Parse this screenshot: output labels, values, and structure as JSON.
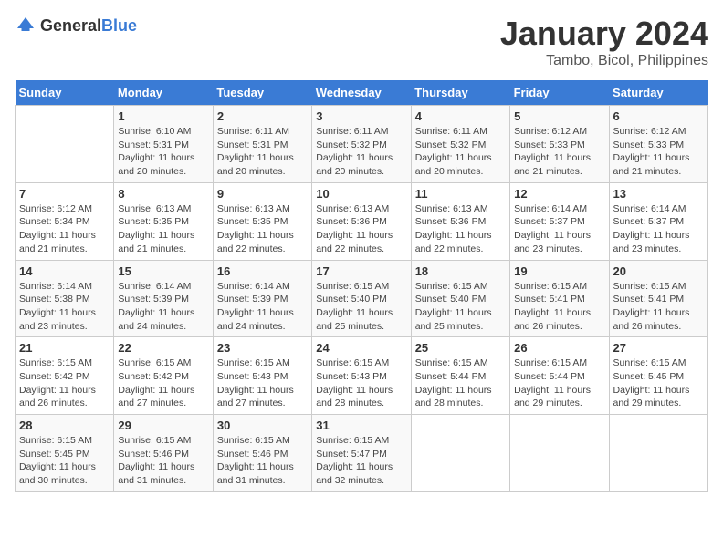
{
  "header": {
    "logo_general": "General",
    "logo_blue": "Blue",
    "title": "January 2024",
    "subtitle": "Tambo, Bicol, Philippines"
  },
  "days_of_week": [
    "Sunday",
    "Monday",
    "Tuesday",
    "Wednesday",
    "Thursday",
    "Friday",
    "Saturday"
  ],
  "weeks": [
    [
      {
        "day": "",
        "info": ""
      },
      {
        "day": "1",
        "info": "Sunrise: 6:10 AM\nSunset: 5:31 PM\nDaylight: 11 hours\nand 20 minutes."
      },
      {
        "day": "2",
        "info": "Sunrise: 6:11 AM\nSunset: 5:31 PM\nDaylight: 11 hours\nand 20 minutes."
      },
      {
        "day": "3",
        "info": "Sunrise: 6:11 AM\nSunset: 5:32 PM\nDaylight: 11 hours\nand 20 minutes."
      },
      {
        "day": "4",
        "info": "Sunrise: 6:11 AM\nSunset: 5:32 PM\nDaylight: 11 hours\nand 20 minutes."
      },
      {
        "day": "5",
        "info": "Sunrise: 6:12 AM\nSunset: 5:33 PM\nDaylight: 11 hours\nand 21 minutes."
      },
      {
        "day": "6",
        "info": "Sunrise: 6:12 AM\nSunset: 5:33 PM\nDaylight: 11 hours\nand 21 minutes."
      }
    ],
    [
      {
        "day": "7",
        "info": "Sunrise: 6:12 AM\nSunset: 5:34 PM\nDaylight: 11 hours\nand 21 minutes."
      },
      {
        "day": "8",
        "info": "Sunrise: 6:13 AM\nSunset: 5:35 PM\nDaylight: 11 hours\nand 21 minutes."
      },
      {
        "day": "9",
        "info": "Sunrise: 6:13 AM\nSunset: 5:35 PM\nDaylight: 11 hours\nand 22 minutes."
      },
      {
        "day": "10",
        "info": "Sunrise: 6:13 AM\nSunset: 5:36 PM\nDaylight: 11 hours\nand 22 minutes."
      },
      {
        "day": "11",
        "info": "Sunrise: 6:13 AM\nSunset: 5:36 PM\nDaylight: 11 hours\nand 22 minutes."
      },
      {
        "day": "12",
        "info": "Sunrise: 6:14 AM\nSunset: 5:37 PM\nDaylight: 11 hours\nand 23 minutes."
      },
      {
        "day": "13",
        "info": "Sunrise: 6:14 AM\nSunset: 5:37 PM\nDaylight: 11 hours\nand 23 minutes."
      }
    ],
    [
      {
        "day": "14",
        "info": "Sunrise: 6:14 AM\nSunset: 5:38 PM\nDaylight: 11 hours\nand 23 minutes."
      },
      {
        "day": "15",
        "info": "Sunrise: 6:14 AM\nSunset: 5:39 PM\nDaylight: 11 hours\nand 24 minutes."
      },
      {
        "day": "16",
        "info": "Sunrise: 6:14 AM\nSunset: 5:39 PM\nDaylight: 11 hours\nand 24 minutes."
      },
      {
        "day": "17",
        "info": "Sunrise: 6:15 AM\nSunset: 5:40 PM\nDaylight: 11 hours\nand 25 minutes."
      },
      {
        "day": "18",
        "info": "Sunrise: 6:15 AM\nSunset: 5:40 PM\nDaylight: 11 hours\nand 25 minutes."
      },
      {
        "day": "19",
        "info": "Sunrise: 6:15 AM\nSunset: 5:41 PM\nDaylight: 11 hours\nand 26 minutes."
      },
      {
        "day": "20",
        "info": "Sunrise: 6:15 AM\nSunset: 5:41 PM\nDaylight: 11 hours\nand 26 minutes."
      }
    ],
    [
      {
        "day": "21",
        "info": "Sunrise: 6:15 AM\nSunset: 5:42 PM\nDaylight: 11 hours\nand 26 minutes."
      },
      {
        "day": "22",
        "info": "Sunrise: 6:15 AM\nSunset: 5:42 PM\nDaylight: 11 hours\nand 27 minutes."
      },
      {
        "day": "23",
        "info": "Sunrise: 6:15 AM\nSunset: 5:43 PM\nDaylight: 11 hours\nand 27 minutes."
      },
      {
        "day": "24",
        "info": "Sunrise: 6:15 AM\nSunset: 5:43 PM\nDaylight: 11 hours\nand 28 minutes."
      },
      {
        "day": "25",
        "info": "Sunrise: 6:15 AM\nSunset: 5:44 PM\nDaylight: 11 hours\nand 28 minutes."
      },
      {
        "day": "26",
        "info": "Sunrise: 6:15 AM\nSunset: 5:44 PM\nDaylight: 11 hours\nand 29 minutes."
      },
      {
        "day": "27",
        "info": "Sunrise: 6:15 AM\nSunset: 5:45 PM\nDaylight: 11 hours\nand 29 minutes."
      }
    ],
    [
      {
        "day": "28",
        "info": "Sunrise: 6:15 AM\nSunset: 5:45 PM\nDaylight: 11 hours\nand 30 minutes."
      },
      {
        "day": "29",
        "info": "Sunrise: 6:15 AM\nSunset: 5:46 PM\nDaylight: 11 hours\nand 31 minutes."
      },
      {
        "day": "30",
        "info": "Sunrise: 6:15 AM\nSunset: 5:46 PM\nDaylight: 11 hours\nand 31 minutes."
      },
      {
        "day": "31",
        "info": "Sunrise: 6:15 AM\nSunset: 5:47 PM\nDaylight: 11 hours\nand 32 minutes."
      },
      {
        "day": "",
        "info": ""
      },
      {
        "day": "",
        "info": ""
      },
      {
        "day": "",
        "info": ""
      }
    ]
  ]
}
